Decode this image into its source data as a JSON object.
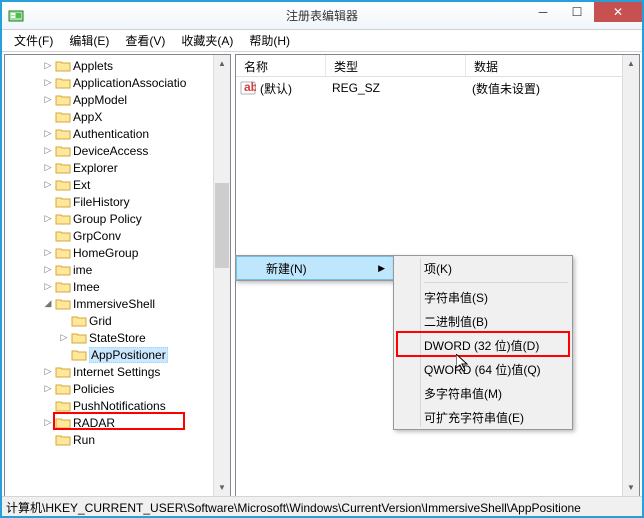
{
  "window": {
    "title": "注册表编辑器"
  },
  "menu": {
    "file": "文件(F)",
    "edit": "编辑(E)",
    "view": "查看(V)",
    "favorites": "收藏夹(A)",
    "help": "帮助(H)"
  },
  "tree": {
    "items": [
      {
        "label": "Applets",
        "depth": 1,
        "exp": "▷"
      },
      {
        "label": "ApplicationAssociatio",
        "depth": 1,
        "exp": "▷"
      },
      {
        "label": "AppModel",
        "depth": 1,
        "exp": "▷"
      },
      {
        "label": "AppX",
        "depth": 1,
        "exp": ""
      },
      {
        "label": "Authentication",
        "depth": 1,
        "exp": "▷"
      },
      {
        "label": "DeviceAccess",
        "depth": 1,
        "exp": "▷"
      },
      {
        "label": "Explorer",
        "depth": 1,
        "exp": "▷"
      },
      {
        "label": "Ext",
        "depth": 1,
        "exp": "▷"
      },
      {
        "label": "FileHistory",
        "depth": 1,
        "exp": ""
      },
      {
        "label": "Group Policy",
        "depth": 1,
        "exp": "▷"
      },
      {
        "label": "GrpConv",
        "depth": 1,
        "exp": ""
      },
      {
        "label": "HomeGroup",
        "depth": 1,
        "exp": "▷"
      },
      {
        "label": "ime",
        "depth": 1,
        "exp": "▷"
      },
      {
        "label": "Imee",
        "depth": 1,
        "exp": "▷"
      },
      {
        "label": "ImmersiveShell",
        "depth": 1,
        "exp": "◢"
      },
      {
        "label": "Grid",
        "depth": 2,
        "exp": ""
      },
      {
        "label": "StateStore",
        "depth": 2,
        "exp": "▷"
      },
      {
        "label": "AppPositioner",
        "depth": 2,
        "exp": "",
        "selected": true
      },
      {
        "label": "Internet Settings",
        "depth": 1,
        "exp": "▷"
      },
      {
        "label": "Policies",
        "depth": 1,
        "exp": "▷"
      },
      {
        "label": "PushNotifications",
        "depth": 1,
        "exp": ""
      },
      {
        "label": "RADAR",
        "depth": 1,
        "exp": "▷"
      },
      {
        "label": "Run",
        "depth": 1,
        "exp": ""
      }
    ]
  },
  "list": {
    "columns": {
      "name": "名称",
      "type": "类型",
      "data": "数据"
    },
    "rows": [
      {
        "name": "(默认)",
        "type": "REG_SZ",
        "data": "(数值未设置)"
      }
    ]
  },
  "context_parent": {
    "new": "新建(N)"
  },
  "context_sub": {
    "key": "项(K)",
    "string": "字符串值(S)",
    "binary": "二进制值(B)",
    "dword": "DWORD (32 位)值(D)",
    "qword": "QWORD (64 位)值(Q)",
    "multi": "多字符串值(M)",
    "expand": "可扩充字符串值(E)"
  },
  "status": "计算机\\HKEY_CURRENT_USER\\Software\\Microsoft\\Windows\\CurrentVersion\\ImmersiveShell\\AppPositione"
}
